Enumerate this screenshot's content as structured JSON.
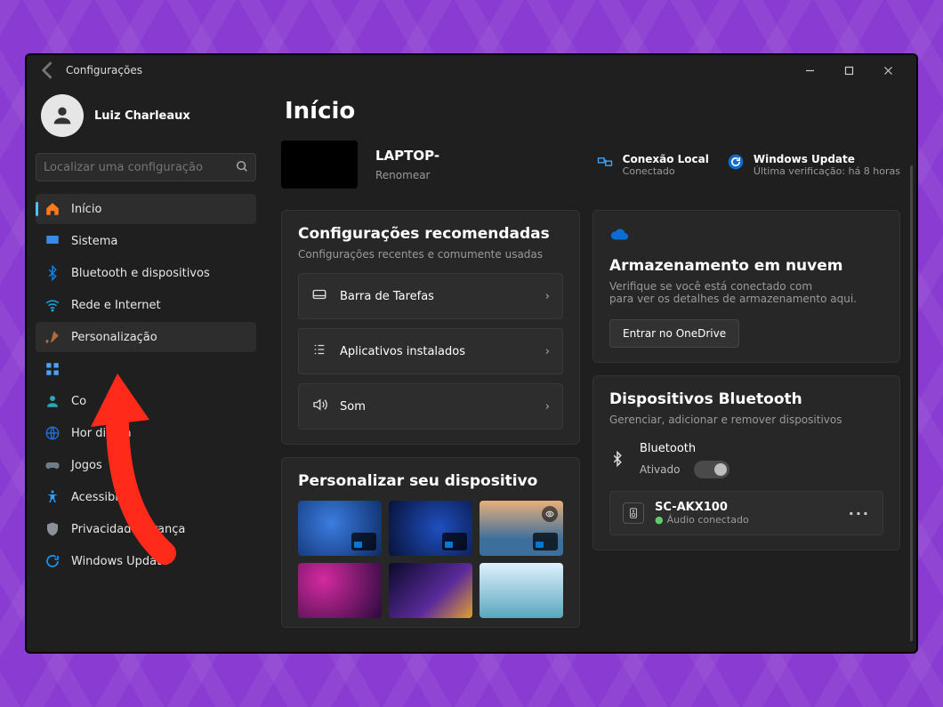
{
  "titlebar": {
    "app": "Configurações"
  },
  "user": {
    "name": "Luiz Charleaux"
  },
  "search": {
    "placeholder": "Localizar uma configuração"
  },
  "sidebar_items": [
    {
      "label": "Início"
    },
    {
      "label": "Sistema"
    },
    {
      "label": "Bluetooth e dispositivos"
    },
    {
      "label": "Rede e Internet"
    },
    {
      "label": "Personalização"
    },
    {
      "label": ""
    },
    {
      "label": "Co"
    },
    {
      "label": "Hor          dioma"
    },
    {
      "label": "Jogos"
    },
    {
      "label": "Acessibili"
    },
    {
      "label": "Privacidade e        rança"
    },
    {
      "label": "Windows Update"
    }
  ],
  "page": {
    "title": "Início"
  },
  "device": {
    "name": "LAPTOP-",
    "rename": "Renomear"
  },
  "header_info": {
    "net": {
      "label": "Conexão Local",
      "sub": "Conectado"
    },
    "wu": {
      "label": "Windows Update",
      "sub": "Última verificação: há 8 horas"
    }
  },
  "rec": {
    "title": "Configurações recomendadas",
    "subtitle": "Configurações recentes e comumente usadas",
    "items": [
      {
        "label": "Barra de Tarefas"
      },
      {
        "label": "Aplicativos instalados"
      },
      {
        "label": "Som"
      }
    ]
  },
  "pers": {
    "title": "Personalizar seu dispositivo"
  },
  "cloud": {
    "title": "Armazenamento em nuvem",
    "subtitle": "Verifique se você está conectado com                      para ver os detalhes de armazenamento aqui.",
    "button": "Entrar no OneDrive"
  },
  "bt": {
    "title": "Dispositivos Bluetooth",
    "subtitle": "Gerenciar, adicionar e remover dispositivos",
    "label": "Bluetooth",
    "state": "Ativado",
    "device": {
      "name": "SC-AKX100",
      "status": "Áudio conectado"
    }
  }
}
